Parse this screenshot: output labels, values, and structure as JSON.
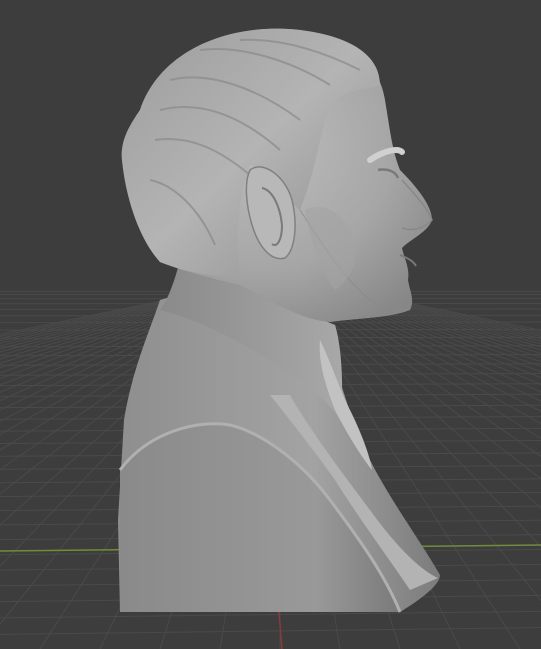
{
  "viewport": {
    "background_color": "#3d3d3d",
    "grid_color": "#4a4a4a",
    "x_axis_color": "#7a9a3a",
    "y_axis_color": "#8a3a3a"
  },
  "model": {
    "object": "bust-sculpture",
    "shading": "solid",
    "base_color": "#9a9a9a",
    "highlight_color": "#c4c4c4",
    "shadow_color": "#6e6e6e"
  }
}
